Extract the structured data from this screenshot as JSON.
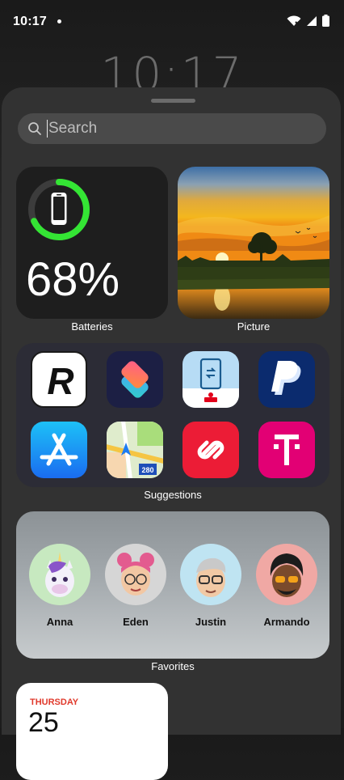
{
  "status": {
    "time": "10:17"
  },
  "lock_clock": "10:17",
  "search": {
    "placeholder": "Search"
  },
  "widgets": {
    "battery": {
      "percent": "68%",
      "label": "Batteries",
      "level": 0.68,
      "ring_color": "#34e534"
    },
    "picture": {
      "label": "Picture"
    },
    "suggestions": {
      "label": "Suggestions",
      "apps": [
        "Revolut",
        "Shortcuts",
        "S-pushTAN",
        "PayPal",
        "App Store",
        "Maps",
        "Authy",
        "T Telekom"
      ]
    },
    "favorites": {
      "label": "Favorites",
      "contacts": [
        "Anna",
        "Eden",
        "Justin",
        "Armando"
      ]
    },
    "calendar": {
      "day": "THURSDAY",
      "date": "25"
    }
  }
}
